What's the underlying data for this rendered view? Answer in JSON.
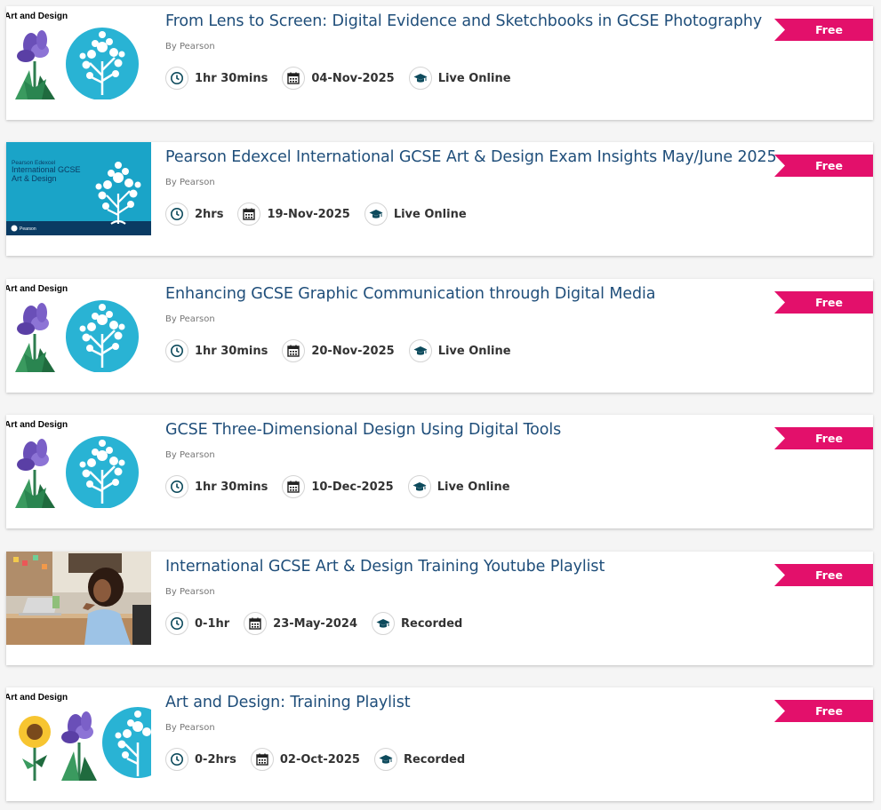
{
  "courses": [
    {
      "thumb": "art-design-iris-tree",
      "thumb_label": "Art and Design",
      "title": "From Lens to Screen: Digital Evidence and Sketchbooks in GCSE Photography",
      "by": "By Pearson",
      "duration": "1hr 30mins",
      "date": "04-Nov-2025",
      "mode": "Live Online",
      "price": "Free"
    },
    {
      "thumb": "pearson-edexcel-banner",
      "thumb_label": "Pearson Edexcel",
      "thumb_line1": "International GCSE",
      "thumb_line2": "Art & Design",
      "thumb_logo": "Pearson",
      "title": "Pearson Edexcel International GCSE Art & Design Exam Insights May/June 2025",
      "by": "By Pearson",
      "duration": "2hrs",
      "date": "19-Nov-2025",
      "mode": "Live Online",
      "price": "Free"
    },
    {
      "thumb": "art-design-iris-tree",
      "thumb_label": "Art and Design",
      "title": "Enhancing GCSE Graphic Communication through Digital Media",
      "by": "By Pearson",
      "duration": "1hr 30mins",
      "date": "20-Nov-2025",
      "mode": "Live Online",
      "price": "Free"
    },
    {
      "thumb": "art-design-iris-tree",
      "thumb_label": "Art and Design",
      "title": "GCSE Three-Dimensional Design Using Digital Tools",
      "by": "By Pearson",
      "duration": "1hr 30mins",
      "date": "10-Dec-2025",
      "mode": "Live Online",
      "price": "Free"
    },
    {
      "thumb": "woman-laptop-photo",
      "title": "International GCSE Art & Design Training Youtube Playlist",
      "by": "By Pearson",
      "duration": "0-1hr",
      "date": "23-May-2024",
      "mode": "Recorded",
      "price": "Free"
    },
    {
      "thumb": "art-design-sunflower-iris-tree",
      "thumb_label": "Art and Design",
      "title": "Art and Design: Training Playlist",
      "by": "By Pearson",
      "duration": "0-2hrs",
      "date": "02-Oct-2025",
      "mode": "Recorded",
      "price": "Free"
    }
  ],
  "icons": {
    "duration": "clock-icon",
    "date": "calendar-icon",
    "mode": "graduation-cap-icon"
  },
  "colors": {
    "title": "#1f4e7a",
    "badge": "#e3106b",
    "icon": "#0d4a5c",
    "thumb_teal": "#29b3d4",
    "banner_teal": "#1aa4c8"
  }
}
